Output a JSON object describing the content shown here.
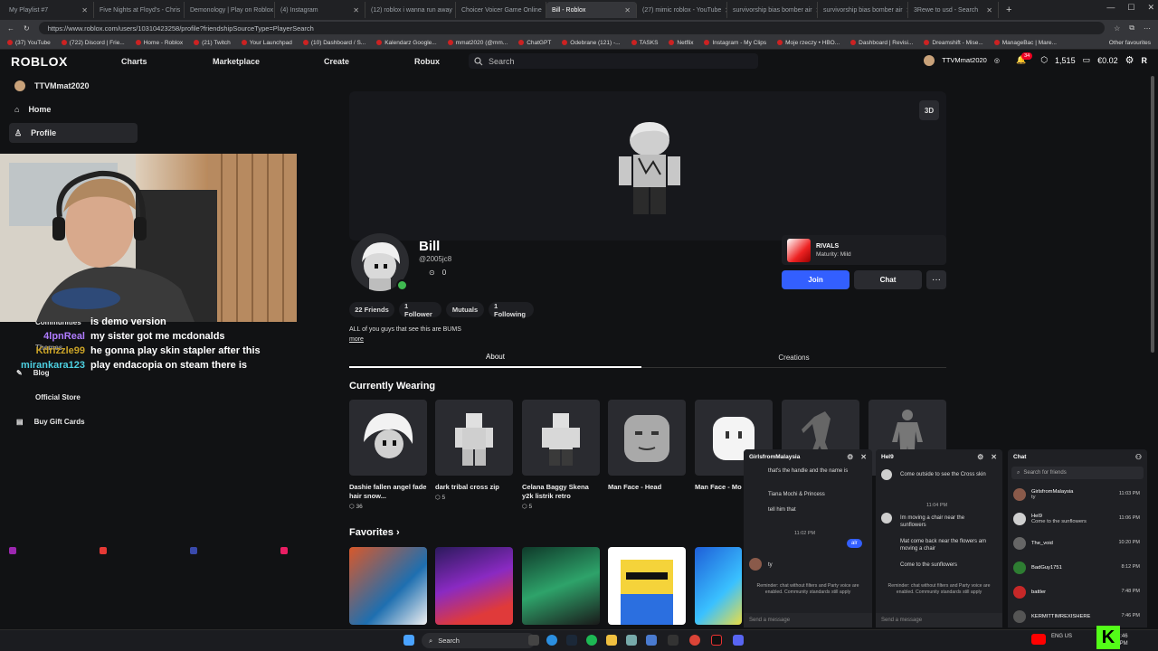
{
  "browser": {
    "tabs": [
      {
        "label": "My Playlist #7",
        "color": "#9c27b0"
      },
      {
        "label": "Five Nights at Floyd's - Chris",
        "color": "#e53935"
      },
      {
        "label": "Demonology | Play on Roblox",
        "color": "#3949ab"
      },
      {
        "label": "(4) Instagram",
        "color": "#e91e63"
      },
      {
        "label": "(12) roblox i wanna run away",
        "color": "#e53935"
      },
      {
        "label": "Choicer Voicer Game Online",
        "color": "#455a64"
      },
      {
        "label": "Bill - Roblox",
        "color": "#1e88e5",
        "active": true
      },
      {
        "label": "(27) mimic roblox - YouTube",
        "color": "#e53935"
      },
      {
        "label": "survivorship bias bomber air",
        "color": "#3949ab"
      },
      {
        "label": "survivorship bias bomber air",
        "color": "#3949ab"
      },
      {
        "label": "3Rewe to usd - Search",
        "color": "#3949ab"
      }
    ],
    "url": "https://www.roblox.com/users/10310423258/profile?friendshipSourceType=PlayerSearch",
    "bookmarks": [
      "(37) YouTube",
      "(722) Discord | Frie...",
      "Home - Roblox",
      "(21) Twitch",
      "Your Launchpad",
      "(10) Dashboard / S...",
      "Kalendarz Google...",
      "mmat2020 (@mm...",
      "ChatGPT",
      "Odebrane (121) -...",
      "TASKS",
      "Netflix",
      "Instagram - My Clips",
      "Moje rzeczy • HBO...",
      "Dashboard | Revisi...",
      "Dreamshift - Mise...",
      "ManageBac | Mare..."
    ],
    "other_favourites": "Other favourites"
  },
  "header": {
    "logo": "ROBLOX",
    "nav": [
      "Charts",
      "Marketplace",
      "Create",
      "Robux"
    ],
    "search_placeholder": "Search",
    "username": "TTVMmat2020",
    "notifications": "34",
    "robux": "1,515",
    "balance": "€0.02"
  },
  "sidebar": {
    "user": "TTVMmat2020",
    "items": [
      "Home",
      "Profile"
    ],
    "lower_items": [
      "Communities",
      "Themes",
      "Blog",
      "Official Store",
      "Buy Gift Cards"
    ]
  },
  "stream_chat": [
    {
      "user": "",
      "text": "is demo version",
      "color": "#ffffff"
    },
    {
      "user": "4lpnReal",
      "text": "my sister got me mcdonalds",
      "color": "#b07cff"
    },
    {
      "user": "Kdrizzle99",
      "text": "he gonna play skin stapler after this",
      "color": "#c9a227"
    },
    {
      "user": "mirankara123",
      "text": "play endacopia on steam there is",
      "color": "#4dd0e1"
    }
  ],
  "profile": {
    "btn_3d": "3D",
    "display_name": "Bill",
    "handle": "@2005jc8",
    "count": "0",
    "game_name": "RIVALS",
    "game_maturity": "Maturity: Mild",
    "join": "Join",
    "chat": "Chat",
    "more": "···",
    "stats": [
      "22 Friends",
      "1 Follower",
      "Mutuals",
      "1 Following"
    ],
    "bio": "ALL of you guys that see this are BUMS",
    "more_link": "more",
    "tabs": [
      "About",
      "Creations"
    ]
  },
  "wearing": {
    "title": "Currently Wearing",
    "items": [
      {
        "name": "Dashie fallen angel fade hair snow...",
        "price": "36"
      },
      {
        "name": "dark tribal cross zip",
        "price": "5"
      },
      {
        "name": "Celana Baggy Skena y2k listrik retro",
        "price": "5"
      },
      {
        "name": "Man Face - Head",
        "price": ""
      },
      {
        "name": "Man Face - Mo",
        "price": ""
      }
    ]
  },
  "favorites": {
    "title": "Favorites ›"
  },
  "chat1": {
    "title": "GirlsfromMalaysia",
    "messages": [
      "that's the handle and the name is",
      "Tiana Mochi & Princess",
      "tell him that"
    ],
    "time": "11:02 PM",
    "sent": "alr",
    "reply": "ty",
    "note": "Reminder: chat without filters and Party voice are enabled. Community standards still apply",
    "input": "Send a message"
  },
  "chat2": {
    "title": "Hel9",
    "messages_a": [
      "Come outside to see the Cross skin"
    ],
    "time": "11:04 PM",
    "messages_b": [
      "Im moving a chair near the sunflowers",
      "Mat come back near the flowers am moving a chair",
      "Come to the sunflowers"
    ],
    "note": "Reminder: chat without filters and Party voice are enabled. Community standards still apply",
    "input": "Send a message"
  },
  "chat_list": {
    "title": "Chat",
    "search": "Search for friends",
    "friends": [
      {
        "name": "GirlsfromMalaysia",
        "msg": "ty",
        "time": "11:03 PM"
      },
      {
        "name": "Hel9",
        "msg": "Come to the sunflowers",
        "time": "11:06 PM"
      },
      {
        "name": "The_void",
        "msg": "",
        "time": "10:20 PM"
      },
      {
        "name": "BadGuy1751",
        "msg": "",
        "time": "8:12 PM"
      },
      {
        "name": "battler",
        "msg": "",
        "time": "7:48 PM"
      },
      {
        "name": "KERMITTIMREXISHERE",
        "msg": "",
        "time": "7:46 PM"
      }
    ]
  },
  "taskbar": {
    "search": "Search",
    "lang": "ENG US",
    "time": "11:46",
    "date": "PM"
  }
}
